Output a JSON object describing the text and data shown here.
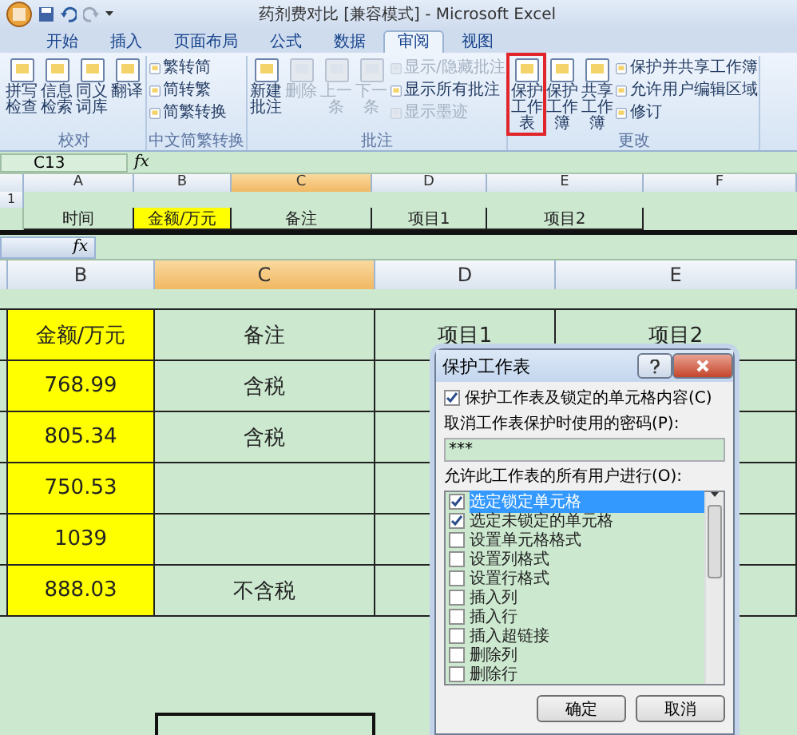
{
  "window": {
    "title": "药剂费对比 [兼容模式] - Microsoft Excel"
  },
  "ribbon_tabs": [
    {
      "label": "开始",
      "selected": false
    },
    {
      "label": "插入",
      "selected": false
    },
    {
      "label": "页面布局",
      "selected": false
    },
    {
      "label": "公式",
      "selected": false
    },
    {
      "label": "数据",
      "selected": false
    },
    {
      "label": "审阅",
      "selected": true
    },
    {
      "label": "视图",
      "selected": false
    }
  ],
  "ribbon_groups": [
    {
      "label": "校对",
      "large": [
        {
          "label": "拼写检查",
          "disabled": false
        },
        {
          "label": "信息检索",
          "disabled": false
        },
        {
          "label": "同义词库",
          "disabled": false
        },
        {
          "label": "翻译",
          "disabled": false
        }
      ]
    },
    {
      "label": "中文简繁转换",
      "small": [
        {
          "label": "繁转简",
          "disabled": false
        },
        {
          "label": "简转繁",
          "disabled": false
        },
        {
          "label": "简繁转换",
          "disabled": false
        }
      ]
    },
    {
      "label": "批注",
      "large": [
        {
          "label": "新建批注",
          "disabled": false
        },
        {
          "label": "删除",
          "disabled": true
        },
        {
          "label": "上一条",
          "disabled": true
        },
        {
          "label": "下一条",
          "disabled": true
        }
      ],
      "small": [
        {
          "label": "显示/隐藏批注",
          "disabled": true
        },
        {
          "label": "显示所有批注",
          "disabled": false
        },
        {
          "label": "显示墨迹",
          "disabled": true
        }
      ]
    },
    {
      "label": "更改",
      "large": [
        {
          "label": "保护工作表",
          "disabled": false,
          "highlighted": true
        },
        {
          "label": "保护工作簿",
          "disabled": false
        },
        {
          "label": "共享工作簿",
          "disabled": false
        }
      ],
      "small": [
        {
          "label": "保护并共享工作簿",
          "disabled": false
        },
        {
          "label": "允许用户编辑区域",
          "disabled": false
        },
        {
          "label": "修订",
          "disabled": false
        }
      ]
    }
  ],
  "name_box": "C13",
  "function_label": "fx",
  "top_sheet": {
    "columns": [
      {
        "label": "A",
        "selected": false
      },
      {
        "label": "B",
        "selected": false
      },
      {
        "label": "C",
        "selected": true
      },
      {
        "label": "D",
        "selected": false
      },
      {
        "label": "E",
        "selected": false
      },
      {
        "label": "F",
        "selected": false
      }
    ],
    "row_number": "1",
    "header_cells": [
      "时间",
      "金额/万元",
      "备注",
      "项目1",
      "项目2"
    ]
  },
  "zoom_sheet": {
    "function_label": "fx",
    "columns": [
      {
        "label": "B",
        "selected": false
      },
      {
        "label": "C",
        "selected": true
      },
      {
        "label": "D",
        "selected": false
      },
      {
        "label": "E",
        "selected": false
      }
    ],
    "header_cells": [
      "金额/万元",
      "备注",
      "项目1",
      "项目2"
    ],
    "rows": [
      {
        "amount": "768.99",
        "note": "含税"
      },
      {
        "amount": "805.34",
        "note": "含税"
      },
      {
        "amount": "750.53"
      },
      {
        "amount": "1039"
      },
      {
        "amount": "888.03",
        "note": "不含税"
      }
    ]
  },
  "dialog": {
    "title": "保护工作表",
    "protect": {
      "label": "保护工作表及锁定的单元格内容(C)",
      "checked": true
    },
    "password_label": "取消工作表保护时使用的密码(P):",
    "password": "***",
    "permissions_label": "允许此工作表的所有用户进行(O):",
    "permissions": [
      {
        "label": "选定锁定单元格",
        "checked": true,
        "selected": true
      },
      {
        "label": "选定未锁定的单元格",
        "checked": true,
        "selected": false
      },
      {
        "label": "设置单元格格式",
        "checked": false,
        "selected": false
      },
      {
        "label": "设置列格式",
        "checked": false,
        "selected": false
      },
      {
        "label": "设置行格式",
        "checked": false,
        "selected": false
      },
      {
        "label": "插入列",
        "checked": false,
        "selected": false
      },
      {
        "label": "插入行",
        "checked": false,
        "selected": false
      },
      {
        "label": "插入超链接",
        "checked": false,
        "selected": false
      },
      {
        "label": "删除列",
        "checked": false,
        "selected": false
      },
      {
        "label": "删除行",
        "checked": false,
        "selected": false
      }
    ],
    "buttons": [
      "确定",
      "取消"
    ]
  }
}
